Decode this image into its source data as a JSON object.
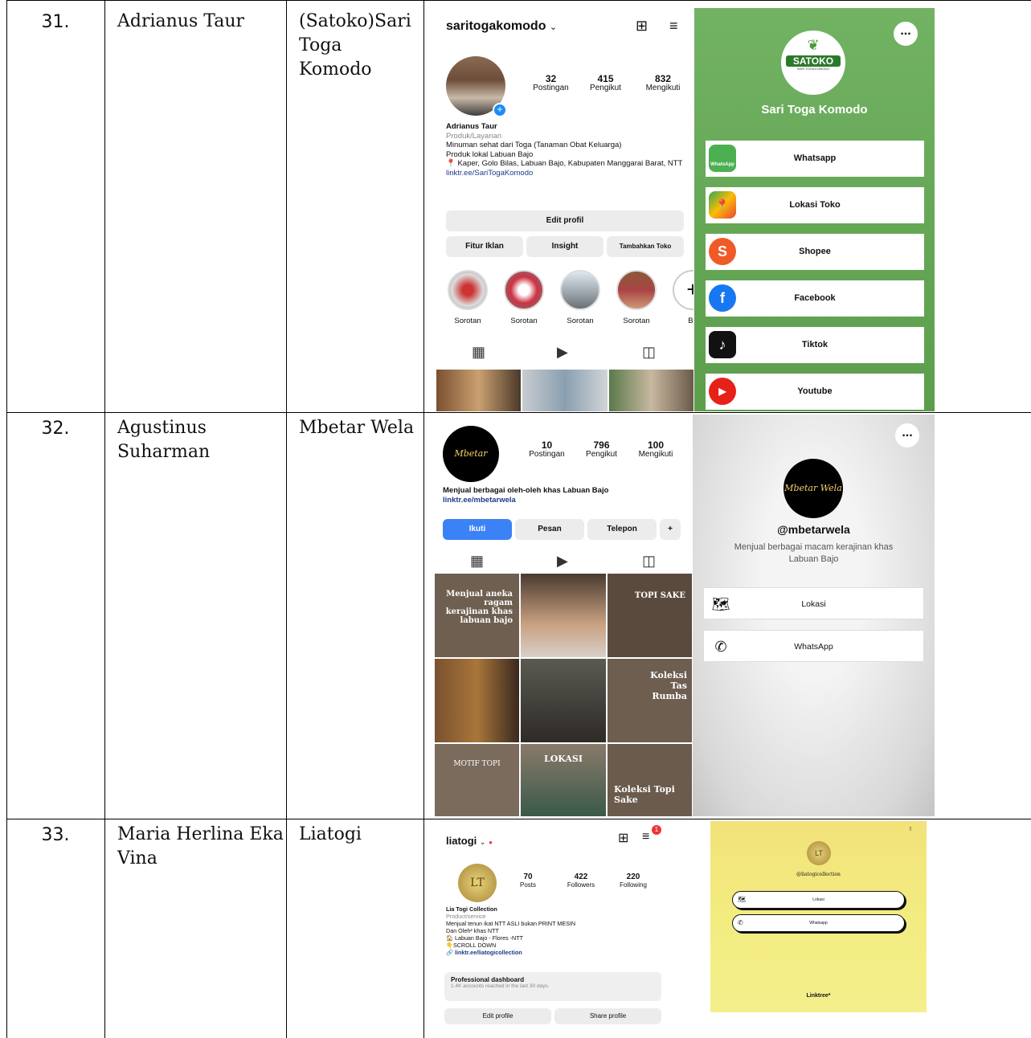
{
  "rows": [
    {
      "number": "31.",
      "name": "Adrianus Taur",
      "business": "(Satoko)Sari Toga Komodo",
      "instagram": {
        "username": "saritogakomodo",
        "posts": "32",
        "posts_label": "Postingan",
        "followers": "415",
        "followers_label": "Pengikut",
        "following": "832",
        "following_label": "Mengikuti",
        "bio_name": "Adrianus Taur",
        "bio_category": "Produk/Layanan",
        "bio_line1": "Minuman sehat dari Toga (Tanaman Obat Keluarga)",
        "bio_line2": "Produk lokal Labuan Bajo",
        "bio_line3": "📍 Kaper, Golo Bilas, Labuan Bajo, Kabupaten Manggarai Barat, NTT",
        "bio_link": "linktr.ee/SariTogaKomodo",
        "edit_profile": "Edit profil",
        "btn_ads": "Fitur Iklan",
        "btn_insight": "Insight",
        "btn_shop": "Tambahkan Toko",
        "highlights": [
          "Sorotan",
          "Sorotan",
          "Sorotan",
          "Sorotan",
          "Ba"
        ]
      },
      "linktree": {
        "logo_text": "SATOKO",
        "logo_subtext": "SARI TOGA KOMODO",
        "title": "Sari Toga Komodo",
        "more_icon": "...",
        "links": [
          "Whatsapp",
          "Lokasi Toko",
          "Shopee",
          "Facebook",
          "Tiktok",
          "Youtube"
        ],
        "whatsapp_icon_label": "WhatsApp",
        "colors": {
          "background": "#6cab5a",
          "button": "#ffffff"
        }
      }
    },
    {
      "number": "32.",
      "name": "Agustinus Suharman",
      "business": "Mbetar Wela",
      "instagram": {
        "logo_text": "Mbetar Wela",
        "posts": "10",
        "posts_label": "Postingan",
        "followers": "796",
        "followers_label": "Pengikut",
        "following": "100",
        "following_label": "Mengikuti",
        "bio_line1": "Menjual berbagai oleh-oleh khas Labuan Bajo",
        "bio_link": "linktr.ee/mbetarwela",
        "btn_follow": "Ikuti",
        "btn_message": "Pesan",
        "btn_phone": "Telepon",
        "btn_add_icon": "+",
        "grid_texts": [
          "Menjual aneka ragam kerajinan khas labuan bajo",
          "",
          "TOPI SAKE",
          "",
          "",
          "Koleksi Tas Rumba",
          "MOTIF TOPI",
          "LOKASI",
          "Koleksi Topi Sake"
        ]
      },
      "linktree": {
        "handle": "@mbetarwela",
        "description": "Menjual berbagai macam kerajinan khas Labuan Bajo",
        "more_icon": "...",
        "links": [
          "Lokasi",
          "WhatsApp"
        ],
        "colors": {
          "background": "#e6e6e6"
        }
      }
    },
    {
      "number": "33.",
      "name": "Maria Herlina Eka Vina",
      "business": "Liatogi",
      "instagram": {
        "username": "liatogi",
        "notification_badge": "1",
        "posts": "70",
        "posts_label": "Posts",
        "followers": "422",
        "followers_label": "Followers",
        "following": "220",
        "following_label": "Following",
        "bio_name": "Lia Togi Collection",
        "bio_category": "Product/service",
        "bio_line1": "Menjual tenun ikat NTT ASLI bukan PRINT MESIN",
        "bio_line2": "Dan Oleh² khas NTT",
        "bio_line3": "🏠 Labuan Bajo - Flores -NTT",
        "bio_line4": "👇SCROLL DOWN",
        "bio_link": "linktr.ee/liatogicollection",
        "dashboard_title": "Professional dashboard",
        "dashboard_sub": "1.4K accounts reached in the last 30 days.",
        "btn_edit": "Edit profile",
        "btn_share": "Share profile"
      },
      "linktree": {
        "handle": "@liatogicollection",
        "links": [
          "Lokasi",
          "Whatsapp"
        ],
        "footer": "Linktree*",
        "colors": {
          "background": "#f2ea7c"
        }
      }
    }
  ]
}
